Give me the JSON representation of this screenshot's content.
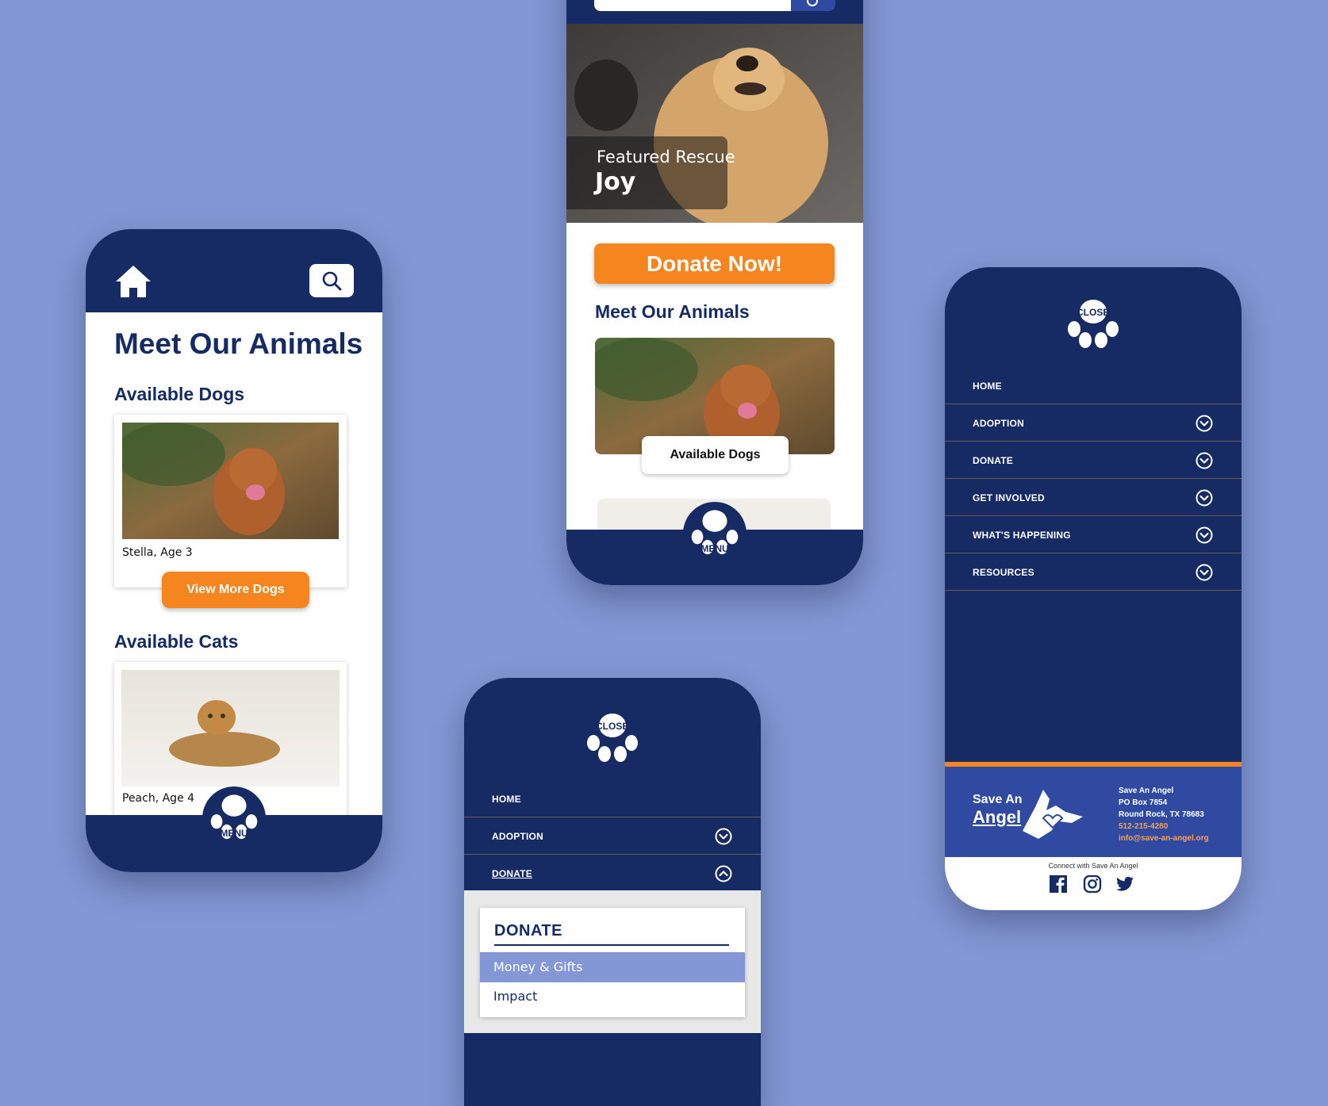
{
  "colors": {
    "navy": "#162a64",
    "accent": "#f5851f",
    "background": "#8297d3",
    "highlight": "#8397d6"
  },
  "phone_list": {
    "title": "Meet Our Animals",
    "dogs_heading": "Available Dogs",
    "dog_caption": "Stella, Age 3",
    "more_dogs_button": "View More Dogs",
    "cats_heading": "Available Cats",
    "cat_caption": "Peach, Age 4",
    "menu_label": "MENU",
    "icons": [
      "home-icon",
      "search-icon",
      "paw-icon"
    ]
  },
  "phone_home": {
    "featured_label": "Featured Rescue",
    "featured_name": "Joy",
    "donate_button": "Donate Now!",
    "section_heading": "Meet Our Animals",
    "card_label": "Available Dogs",
    "menu_label": "MENU"
  },
  "phone_donate_menu": {
    "close_label": "CLOSE",
    "items": [
      {
        "label": "HOME"
      },
      {
        "label": "ADOPTION"
      },
      {
        "label": "DONATE"
      }
    ],
    "dropdown": {
      "title": "DONATE",
      "items": [
        "Money & Gifts",
        "Impact"
      ],
      "selected": "Money & Gifts"
    }
  },
  "phone_full_menu": {
    "close_label": "CLOSE",
    "items": [
      {
        "label": "HOME"
      },
      {
        "label": "ADOPTION"
      },
      {
        "label": "DONATE"
      },
      {
        "label": "GET INVOLVED"
      },
      {
        "label": "WHAT'S HAPPENING"
      },
      {
        "label": "RESOURCES"
      }
    ],
    "footer": {
      "logo_line1": "Save An",
      "logo_line2": "Angel",
      "org": "Save An Angel",
      "address1": "PO Box 7854",
      "address2": "Round Rock, TX 78683",
      "phone": "512-215-4280",
      "email": "info@save-an-angel.org",
      "connect": "Connect with Save An Angel",
      "social": [
        "facebook-icon",
        "instagram-icon",
        "twitter-icon"
      ]
    }
  }
}
